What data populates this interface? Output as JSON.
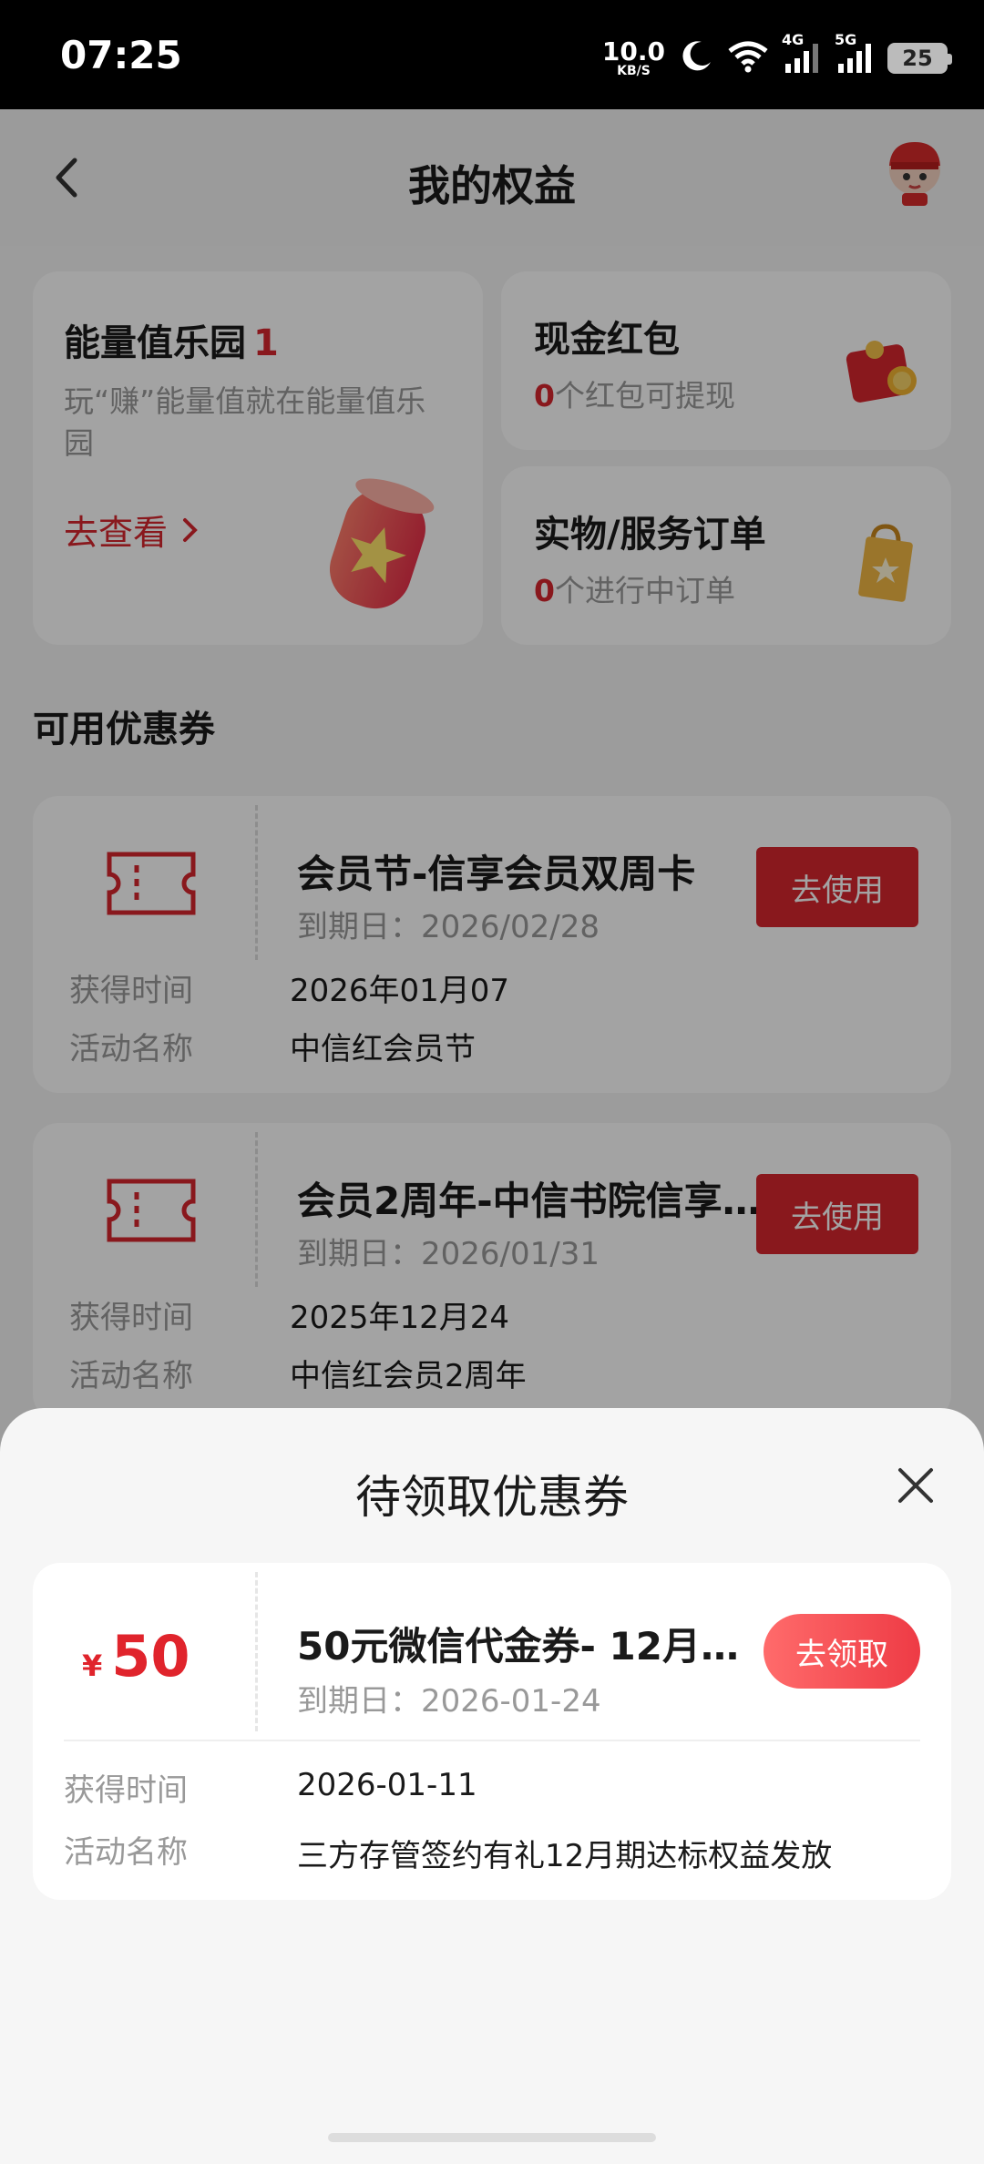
{
  "status_bar": {
    "time": "07:25",
    "net_speed_value": "10.0",
    "net_speed_unit": "KB/S",
    "signal1_label": "4G",
    "signal2_label": "5G",
    "battery": "25"
  },
  "header": {
    "title": "我的权益"
  },
  "energy_card": {
    "title": "能量值乐园",
    "count": "1",
    "desc": "玩“赚”能量值就在能量值乐园",
    "link": "去查看"
  },
  "cash_card": {
    "title": "现金红包",
    "count": "0",
    "desc": "个红包可提现"
  },
  "orders_card": {
    "title": "实物/服务订单",
    "count": "0",
    "desc": "个进行中订单"
  },
  "section": {
    "available_title": "可用优惠券"
  },
  "coupons": [
    {
      "name": "会员节-信享会员双周卡",
      "expiry": "到期日：2026/02/28",
      "button": "去使用",
      "label_time": "获得时间",
      "time": "2026年01月07",
      "label_activity": "活动名称",
      "activity": "中信红会员节"
    },
    {
      "name": "会员2周年-中信书院信享…",
      "expiry": "到期日：2026/01/31",
      "button": "去使用",
      "label_time": "获得时间",
      "time": "2025年12月24",
      "label_activity": "活动名称",
      "activity": "中信红会员2周年"
    }
  ],
  "sheet": {
    "title": "待领取优惠券",
    "coupon": {
      "currency": "¥",
      "amount": "50",
      "name": "50元微信代金券- 12月…",
      "expiry": "到期日：2026-01-24",
      "button": "去领取",
      "label_time": "获得时间",
      "time": "2026-01-11",
      "label_activity": "活动名称",
      "activity": "三方存管签约有礼12月期达标权益发放"
    }
  },
  "colors": {
    "accent_red": "#d7262e",
    "claim_gradient_start": "#ff6b6b",
    "claim_gradient_end": "#ee3b45"
  }
}
